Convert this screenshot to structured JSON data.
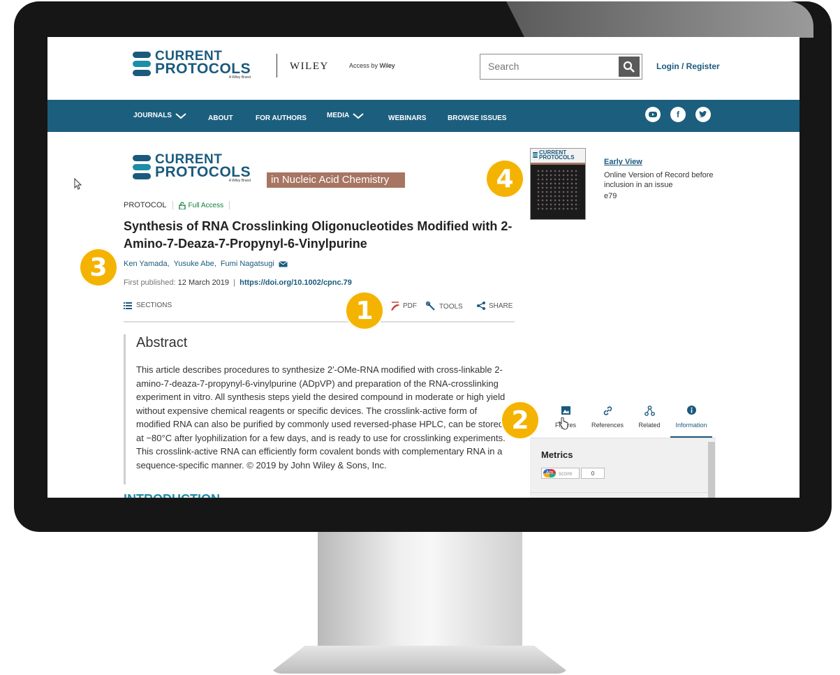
{
  "header": {
    "logo_line1": "CURRENT",
    "logo_line2": "PROTOCOLS",
    "logo_sub": "A Wiley Brand",
    "wiley": "WILEY",
    "access_prefix": "Access by",
    "access_brand": "Wiley",
    "search_placeholder": "Search",
    "login": "Login / Register"
  },
  "nav": {
    "items": [
      "JOURNALS",
      "ABOUT",
      "FOR AUTHORS",
      "MEDIA",
      "WEBINARS",
      "BROWSE ISSUES"
    ],
    "social": [
      "youtube-icon",
      "facebook-icon",
      "twitter-icon"
    ]
  },
  "journal": {
    "badge": "in Nucleic Acid Chemistry"
  },
  "article": {
    "type": "PROTOCOL",
    "access": "Full Access",
    "title": "Synthesis of RNA Crosslinking Oligonucleotides Modified with 2-Amino-7-Deaza-7-Propynyl-6-Vinylpurine",
    "authors": [
      "Ken Yamada,",
      "Yusuke Abe,",
      "Fumi Nagatsugi"
    ],
    "first_published_label": "First published:",
    "first_published_date": "12 March 2019",
    "doi": "https://doi.org/10.1002/cpnc.79",
    "sections_label": "SECTIONS",
    "pdf_label": "PDF",
    "tools_label": "TOOLS",
    "share_label": "SHARE",
    "abstract_heading": "Abstract",
    "abstract_text": "This article describes procedures to synthesize 2′-OMe-RNA modified with cross-linkable 2-amino-7-deaza-7-propynyl-6-vinylpurine (ADpVP) and preparation of the RNA-crosslinking experiment in vitro. All synthesis steps yield the desired compound in moderate or high yield without expensive chemical reagents or specific devices. The crosslink-active form of modified RNA can also be purified by commonly used reversed-phase HPLC, can be stored at −80°C after lyophilization for a few days, and is ready to use for crosslinking experiments. This crosslink-active RNA can efficiently form covalent bonds with complementary RNA in a sequence-specific manner. © 2019 by John Wiley & Sons, Inc.",
    "next_heading": "INTRODUCTION"
  },
  "sidebar": {
    "early_view_title": "Early View",
    "early_view_text": "Online Version of Record before inclusion in an issue",
    "issue_id": "e79",
    "cover_line1": "CURRENT",
    "cover_line2": "PROTOCOLS",
    "tabs": [
      "Figures",
      "References",
      "Related",
      "Information"
    ],
    "metrics_heading": "Metrics",
    "altmetric_label": "score",
    "altmetric_badge": "Am",
    "altmetric_value": "0"
  },
  "callouts": [
    "1",
    "2",
    "3",
    "4"
  ],
  "colors": {
    "brand_navy": "#1a5a7d",
    "nav_bar": "#1c5e7d",
    "brand_teal": "#1c8ea6",
    "journal_badge": "#a77562",
    "callout_yellow": "#f5b301",
    "full_access_green": "#0f7d3a"
  }
}
